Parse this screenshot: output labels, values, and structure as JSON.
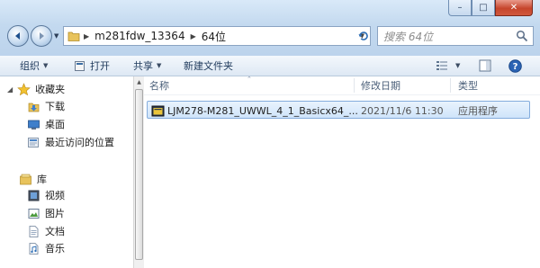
{
  "window": {
    "controls": {
      "minimize": "–",
      "maximize": "□",
      "close": "✕"
    },
    "address": {
      "segments": [
        "m281fdw_13364",
        "64位"
      ]
    },
    "search": {
      "placeholder": "搜索 64位"
    }
  },
  "toolbar": {
    "organize": "组织",
    "open": "打开",
    "share": "共享",
    "new_folder": "新建文件夹"
  },
  "nav": {
    "favorites_header": "收藏夹",
    "favorites": [
      "下载",
      "桌面",
      "最近访问的位置"
    ],
    "libraries_header": "库",
    "libraries": [
      "视频",
      "图片",
      "文档",
      "音乐"
    ]
  },
  "columns": {
    "name": "名称",
    "modified": "修改日期",
    "type": "类型"
  },
  "files": [
    {
      "name": "LJM278-M281_UWWL_4_1_Basicx64_...",
      "modified": "2021/11/6 11:30",
      "type": "应用程序"
    }
  ],
  "colors": {
    "accent": "#3a6ea5",
    "selection": "#cfe4fa"
  }
}
